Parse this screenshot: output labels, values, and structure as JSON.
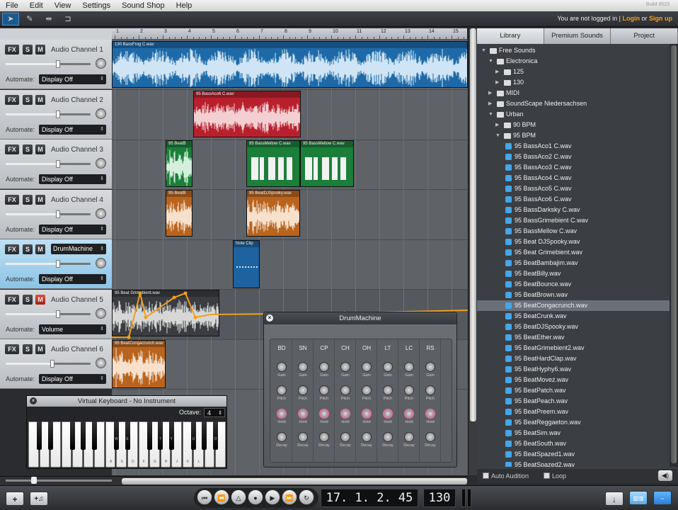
{
  "menu": [
    "File",
    "Edit",
    "View",
    "Settings",
    "Sound Shop",
    "Help"
  ],
  "build": "Build 9523",
  "toolbar": {
    "tools": [
      "arrow-tool",
      "draw-tool",
      "split-tool",
      "glue-tool"
    ]
  },
  "login": {
    "prefix": "You are not logged in |",
    "login": "Login",
    "or": "or",
    "signup": "Sign up"
  },
  "ruler": {
    "numbers": [
      "1",
      "2",
      "3",
      "4",
      "5",
      "6",
      "7",
      "8",
      "9",
      "10",
      "11",
      "12",
      "13",
      "14",
      "15"
    ]
  },
  "tracks": [
    {
      "fx": "FX",
      "s": "S",
      "m": "M",
      "name": "Audio Channel 1",
      "volume": 0.62,
      "automate_label": "Automate:",
      "automate": "Display Off",
      "mute": false
    },
    {
      "fx": "FX",
      "s": "S",
      "m": "M",
      "name": "Audio Channel 2",
      "volume": 0.62,
      "automate_label": "Automate:",
      "automate": "Display Off",
      "mute": false
    },
    {
      "fx": "FX",
      "s": "S",
      "m": "M",
      "name": "Audio Channel 3",
      "volume": 0.62,
      "automate_label": "Automate:",
      "automate": "Display Off",
      "mute": false
    },
    {
      "fx": "FX",
      "s": "S",
      "m": "M",
      "name": "Audio Channel 4",
      "volume": 0.62,
      "automate_label": "Automate:",
      "automate": "Display Off",
      "mute": false
    },
    {
      "fx": "FX",
      "s": "S",
      "m": "M",
      "name": "DrumMachine",
      "volume": 0.62,
      "automate_label": "Automate:",
      "automate": "Display Off",
      "mute": false
    },
    {
      "fx": "FX",
      "s": "S",
      "m": "M",
      "name": "Audio Channel 5",
      "volume": 0.62,
      "automate_label": "Automate:",
      "automate": "Volume",
      "mute": true
    },
    {
      "fx": "FX",
      "s": "S",
      "m": "M",
      "name": "Audio Channel 6",
      "volume": 0.55,
      "automate_label": "Automate:",
      "automate": "Display Off",
      "mute": false
    }
  ],
  "clips": [
    {
      "title": "130 BassFrog C.wav",
      "color": "#1e6aa8"
    },
    {
      "title": "95 BassAco6 C.wav",
      "color": "#b9202e"
    },
    {
      "title": "95 BeatB",
      "color": "#1b7f3a"
    },
    {
      "title": "95 BassMellow C.wav",
      "color": "#1b7f3a"
    },
    {
      "title": "95 BassMellow C.wav",
      "color": "#1b7f3a"
    },
    {
      "title": "95 BeatB",
      "color": "#b9641e"
    },
    {
      "title": "95 BeatDJSpooky.wav",
      "color": "#b9641e"
    },
    {
      "title": "Note Clip",
      "color": "#1f62a0"
    },
    {
      "title": "95 Beat Grimebient.wav",
      "color": "#3a3c40"
    },
    {
      "title": "95 BeatCongacrunch.wav",
      "color": "#b9641e"
    }
  ],
  "browser": {
    "tabs": [
      "Library",
      "Premium Sounds",
      "Project"
    ],
    "tree": [
      {
        "label": "Free Sounds",
        "type": "folder",
        "level": 0,
        "open": true
      },
      {
        "label": "Electronica",
        "type": "folder",
        "level": 1,
        "open": true
      },
      {
        "label": "125",
        "type": "folder",
        "level": 2,
        "open": false
      },
      {
        "label": "130",
        "type": "folder",
        "level": 2,
        "open": false
      },
      {
        "label": "MIDI",
        "type": "folder",
        "level": 1,
        "open": false
      },
      {
        "label": "SoundScape Niedersachsen",
        "type": "folder",
        "level": 1,
        "open": false
      },
      {
        "label": "Urban",
        "type": "folder",
        "level": 1,
        "open": true
      },
      {
        "label": "90 BPM",
        "type": "folder",
        "level": 2,
        "open": false
      },
      {
        "label": "95 BPM",
        "type": "folder",
        "level": 2,
        "open": true
      },
      {
        "label": "95 BassAco1 C.wav",
        "type": "file",
        "level": 3
      },
      {
        "label": "95 BassAco2 C.wav",
        "type": "file",
        "level": 3
      },
      {
        "label": "95 BassAco3 C.wav",
        "type": "file",
        "level": 3
      },
      {
        "label": "95 BassAco4 C.wav",
        "type": "file",
        "level": 3
      },
      {
        "label": "95 BassAco5 C.wav",
        "type": "file",
        "level": 3
      },
      {
        "label": "95 BassAco6 C.wav",
        "type": "file",
        "level": 3
      },
      {
        "label": "95 BassDarksky C.wav",
        "type": "file",
        "level": 3
      },
      {
        "label": "95 BassGrimebient C.wav",
        "type": "file",
        "level": 3
      },
      {
        "label": "95 BassMellow C.wav",
        "type": "file",
        "level": 3
      },
      {
        "label": "95 Beat DJSpooky.wav",
        "type": "file",
        "level": 3
      },
      {
        "label": "95 Beat Grimebient.wav",
        "type": "file",
        "level": 3
      },
      {
        "label": "95 BeatBambajim.wav",
        "type": "file",
        "level": 3
      },
      {
        "label": "95 BeatBilly.wav",
        "type": "file",
        "level": 3
      },
      {
        "label": "95 BeatBounce.wav",
        "type": "file",
        "level": 3
      },
      {
        "label": "95 BeatBrown.wav",
        "type": "file",
        "level": 3
      },
      {
        "label": "95 BeatCongacrunch.wav",
        "type": "file",
        "level": 3,
        "selected": true
      },
      {
        "label": "95 BeatCrunk.wav",
        "type": "file",
        "level": 3
      },
      {
        "label": "95 BeatDJSpooky.wav",
        "type": "file",
        "level": 3
      },
      {
        "label": "95 BeatEther.wav",
        "type": "file",
        "level": 3
      },
      {
        "label": "95 BeatGrimebient2.wav",
        "type": "file",
        "level": 3
      },
      {
        "label": "95 BeatHardClap.wav",
        "type": "file",
        "level": 3
      },
      {
        "label": "95 BeatHyphy6.wav",
        "type": "file",
        "level": 3
      },
      {
        "label": "95 BeatMovez.wav",
        "type": "file",
        "level": 3
      },
      {
        "label": "95 BeatPatch.wav",
        "type": "file",
        "level": 3
      },
      {
        "label": "95 BeatPeach.wav",
        "type": "file",
        "level": 3
      },
      {
        "label": "95 BeatPreem.wav",
        "type": "file",
        "level": 3
      },
      {
        "label": "95 BeatReggaeton.wav",
        "type": "file",
        "level": 3
      },
      {
        "label": "95 BeatSim.wav",
        "type": "file",
        "level": 3
      },
      {
        "label": "95 BeatSouth.wav",
        "type": "file",
        "level": 3
      },
      {
        "label": "95 BeatSpazed1.wav",
        "type": "file",
        "level": 3
      },
      {
        "label": "95 BeatSpazed2.wav",
        "type": "file",
        "level": 3
      }
    ],
    "auto_audition": "Auto Audition",
    "loop": "Loop"
  },
  "drum": {
    "title": "DrumMachine",
    "channels": [
      "BD",
      "SN",
      "CP",
      "CH",
      "OH",
      "LT",
      "LC",
      "RS"
    ],
    "params": [
      "Gain",
      "Pitch",
      "Hold",
      "Decay"
    ]
  },
  "vkeyboard": {
    "title": "Virtual Keyboard - No Instrument",
    "octave_label": "Octave:",
    "octave": "4",
    "white_keys": [
      "",
      "",
      "",
      "",
      "",
      "",
      "",
      "A",
      "S",
      "D",
      "F",
      "G",
      "H",
      "J",
      "K",
      "L",
      "",
      ""
    ],
    "black_keys": [
      "",
      "",
      "",
      "",
      "",
      "W",
      "E",
      "",
      "T",
      "Y",
      "U",
      "",
      "O",
      "P"
    ]
  },
  "transport": {
    "position": "17. 1. 2.  45",
    "tempo": "130"
  }
}
